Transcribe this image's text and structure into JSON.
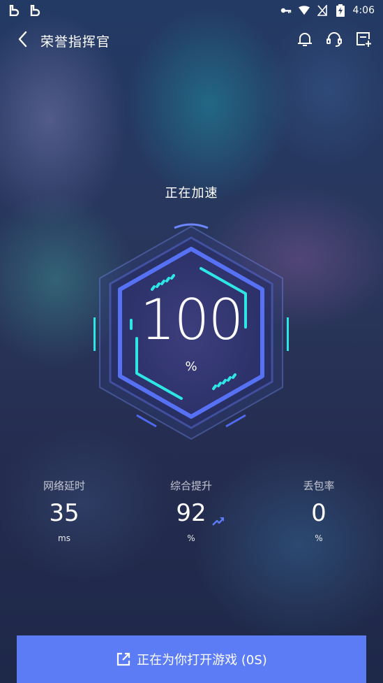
{
  "status_bar": {
    "time": "4:06",
    "left_icons": [
      "b-app-icon",
      "b-app-icon"
    ],
    "right_icons": [
      "key-icon",
      "wifi-icon",
      "no-sim-icon",
      "battery-charging-icon"
    ]
  },
  "header": {
    "title": "荣誉指挥官",
    "back_icon": "chevron-left-icon",
    "action_icons": [
      "bell-icon",
      "headset-icon",
      "add-shortcut-icon"
    ]
  },
  "accelerate": {
    "status": "正在加速",
    "progress_value": "100",
    "progress_unit": "%"
  },
  "stats": [
    {
      "label": "网络延时",
      "value": "35",
      "unit": "ms"
    },
    {
      "label": "综合提升",
      "value": "92",
      "unit": "%",
      "trend": "up"
    },
    {
      "label": "丢包率",
      "value": "0",
      "unit": "%"
    }
  ],
  "open_button": {
    "label": "正在为你打开游戏 (0S)",
    "icon": "external-link-icon"
  },
  "colors": {
    "accent_blue": "#5b7cf5",
    "hex_inner": "#4f6af0",
    "tick_cyan": "#2ee6e6"
  }
}
